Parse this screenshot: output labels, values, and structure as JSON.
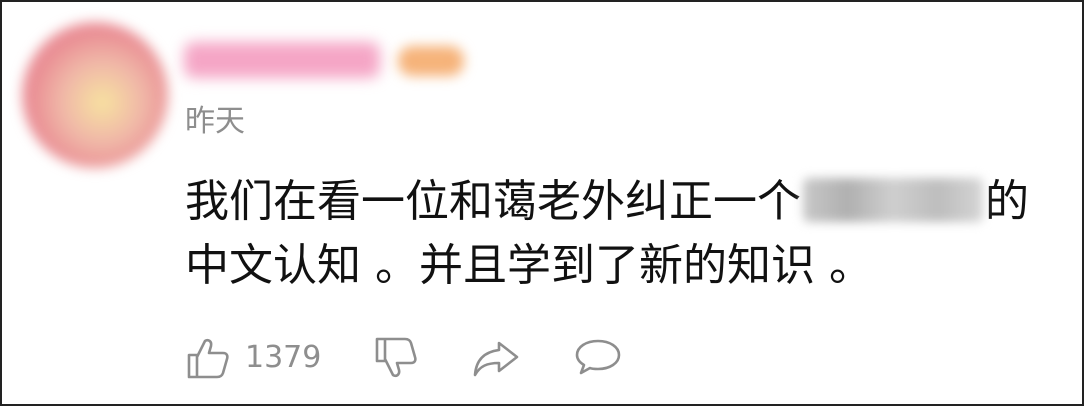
{
  "comment": {
    "timestamp": "昨天",
    "text_line1_before": "我们在看一位和蔼老外纠正一个",
    "text_line1_after": "的",
    "text_line2": "中文认知 。并且学到了新的知识 。"
  },
  "actions": {
    "like_count": "1379",
    "like_icon": "thumbs-up-icon",
    "dislike_icon": "thumbs-down-icon",
    "share_icon": "share-icon",
    "reply_icon": "comment-icon"
  }
}
